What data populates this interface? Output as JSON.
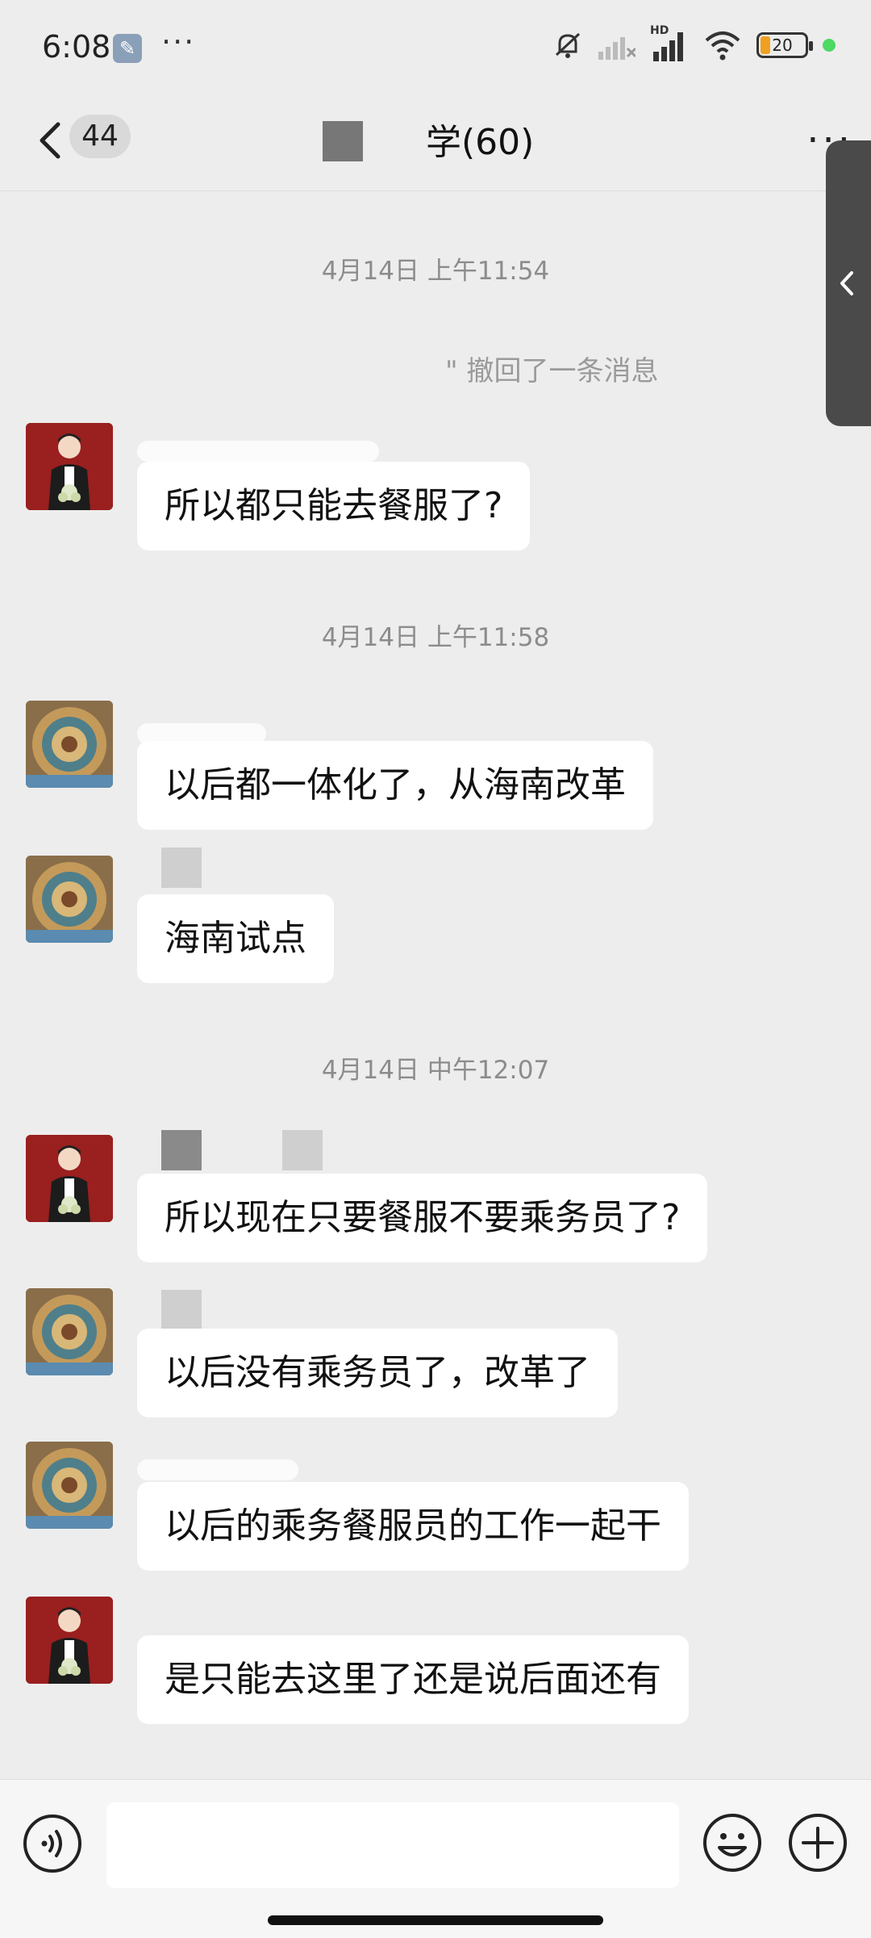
{
  "status_bar": {
    "time": "6:08",
    "more": "···",
    "network_label": "HD",
    "battery": "20"
  },
  "nav": {
    "unread_count": "44",
    "title": "学(60)",
    "more": "···"
  },
  "chat": {
    "recall_note": "\" 撤回了一条消息",
    "timestamps": [
      "4月14日 上午11:54",
      "4月14日 上午11:58",
      "4月14日 中午12:07"
    ],
    "messages": [
      {
        "avatar": "red-avatar",
        "text": "所以都只能去餐服了?"
      },
      {
        "avatar": "mosaic-avatar",
        "text": "以后都一体化了，从海南改革"
      },
      {
        "avatar": "mosaic-avatar",
        "text": "海南试点"
      },
      {
        "avatar": "red-avatar",
        "text": "所以现在只要餐服不要乘务员了?"
      },
      {
        "avatar": "mosaic-avatar",
        "text": "以后没有乘务员了，改革了"
      },
      {
        "avatar": "mosaic-avatar",
        "text": "以后的乘务餐服员的工作一起干"
      },
      {
        "avatar": "red-avatar",
        "text": "是只能去这里了还是说后面还有"
      }
    ]
  },
  "colors": {
    "background": "#ededed",
    "bubble": "#ffffff",
    "timestamp_text": "#8c8c8c"
  }
}
